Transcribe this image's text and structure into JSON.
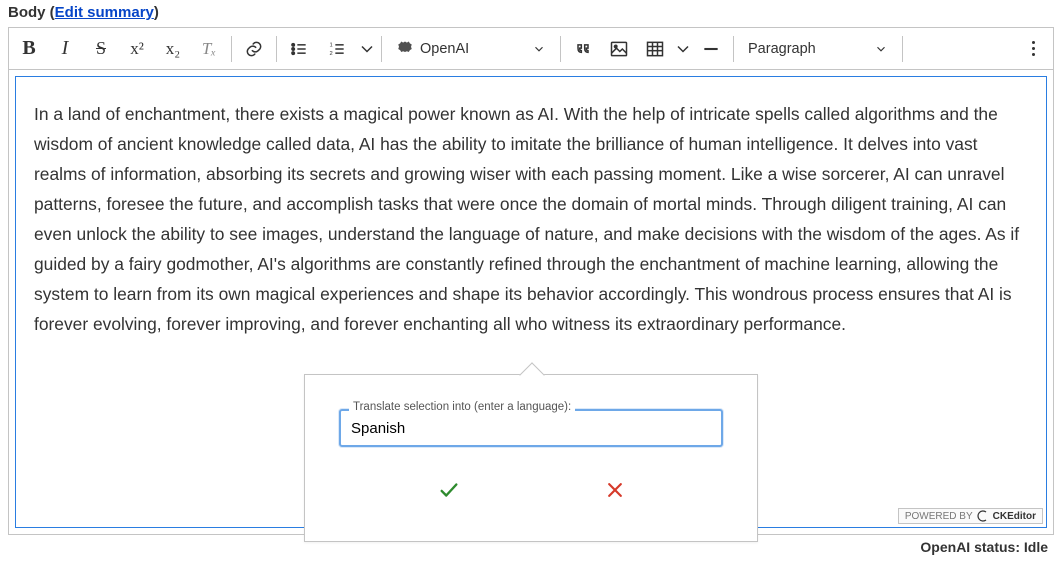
{
  "header": {
    "label_prefix": "Body (",
    "edit_link": "Edit summary",
    "label_suffix": ")"
  },
  "toolbar": {
    "openai_label": "OpenAI",
    "paragraph_label": "Paragraph",
    "superscript": "x²",
    "subscript": "x₂",
    "clear_format": "Tₓ"
  },
  "content": {
    "text": "In a land of enchantment, there exists a magical power known as AI. With the help of intricate spells called algorithms and the wisdom of ancient knowledge called data, AI has the ability to imitate the brilliance of human intelligence. It delves into vast realms of information, absorbing its secrets and growing wiser with each passing moment. Like a wise sorcerer, AI can unravel patterns, foresee the future, and accomplish tasks that were once the domain of mortal minds. Through diligent training, AI can even unlock the ability to see images, understand the language of nature, and make decisions with the wisdom of the ages. As if guided by a fairy godmother, AI's algorithms are constantly refined through the enchantment of machine learning, allowing the system to learn from its own magical experiences and shape its behavior accordingly. This wondrous process ensures that AI is forever evolving, forever improving, and forever enchanting all who witness its extraordinary performance."
  },
  "popup": {
    "legend": "Translate selection into (enter a language):",
    "value": "Spanish"
  },
  "footer": {
    "powered_prefix": "POWERED BY",
    "powered_brand": "CKEditor",
    "status": "OpenAI status: Idle"
  }
}
